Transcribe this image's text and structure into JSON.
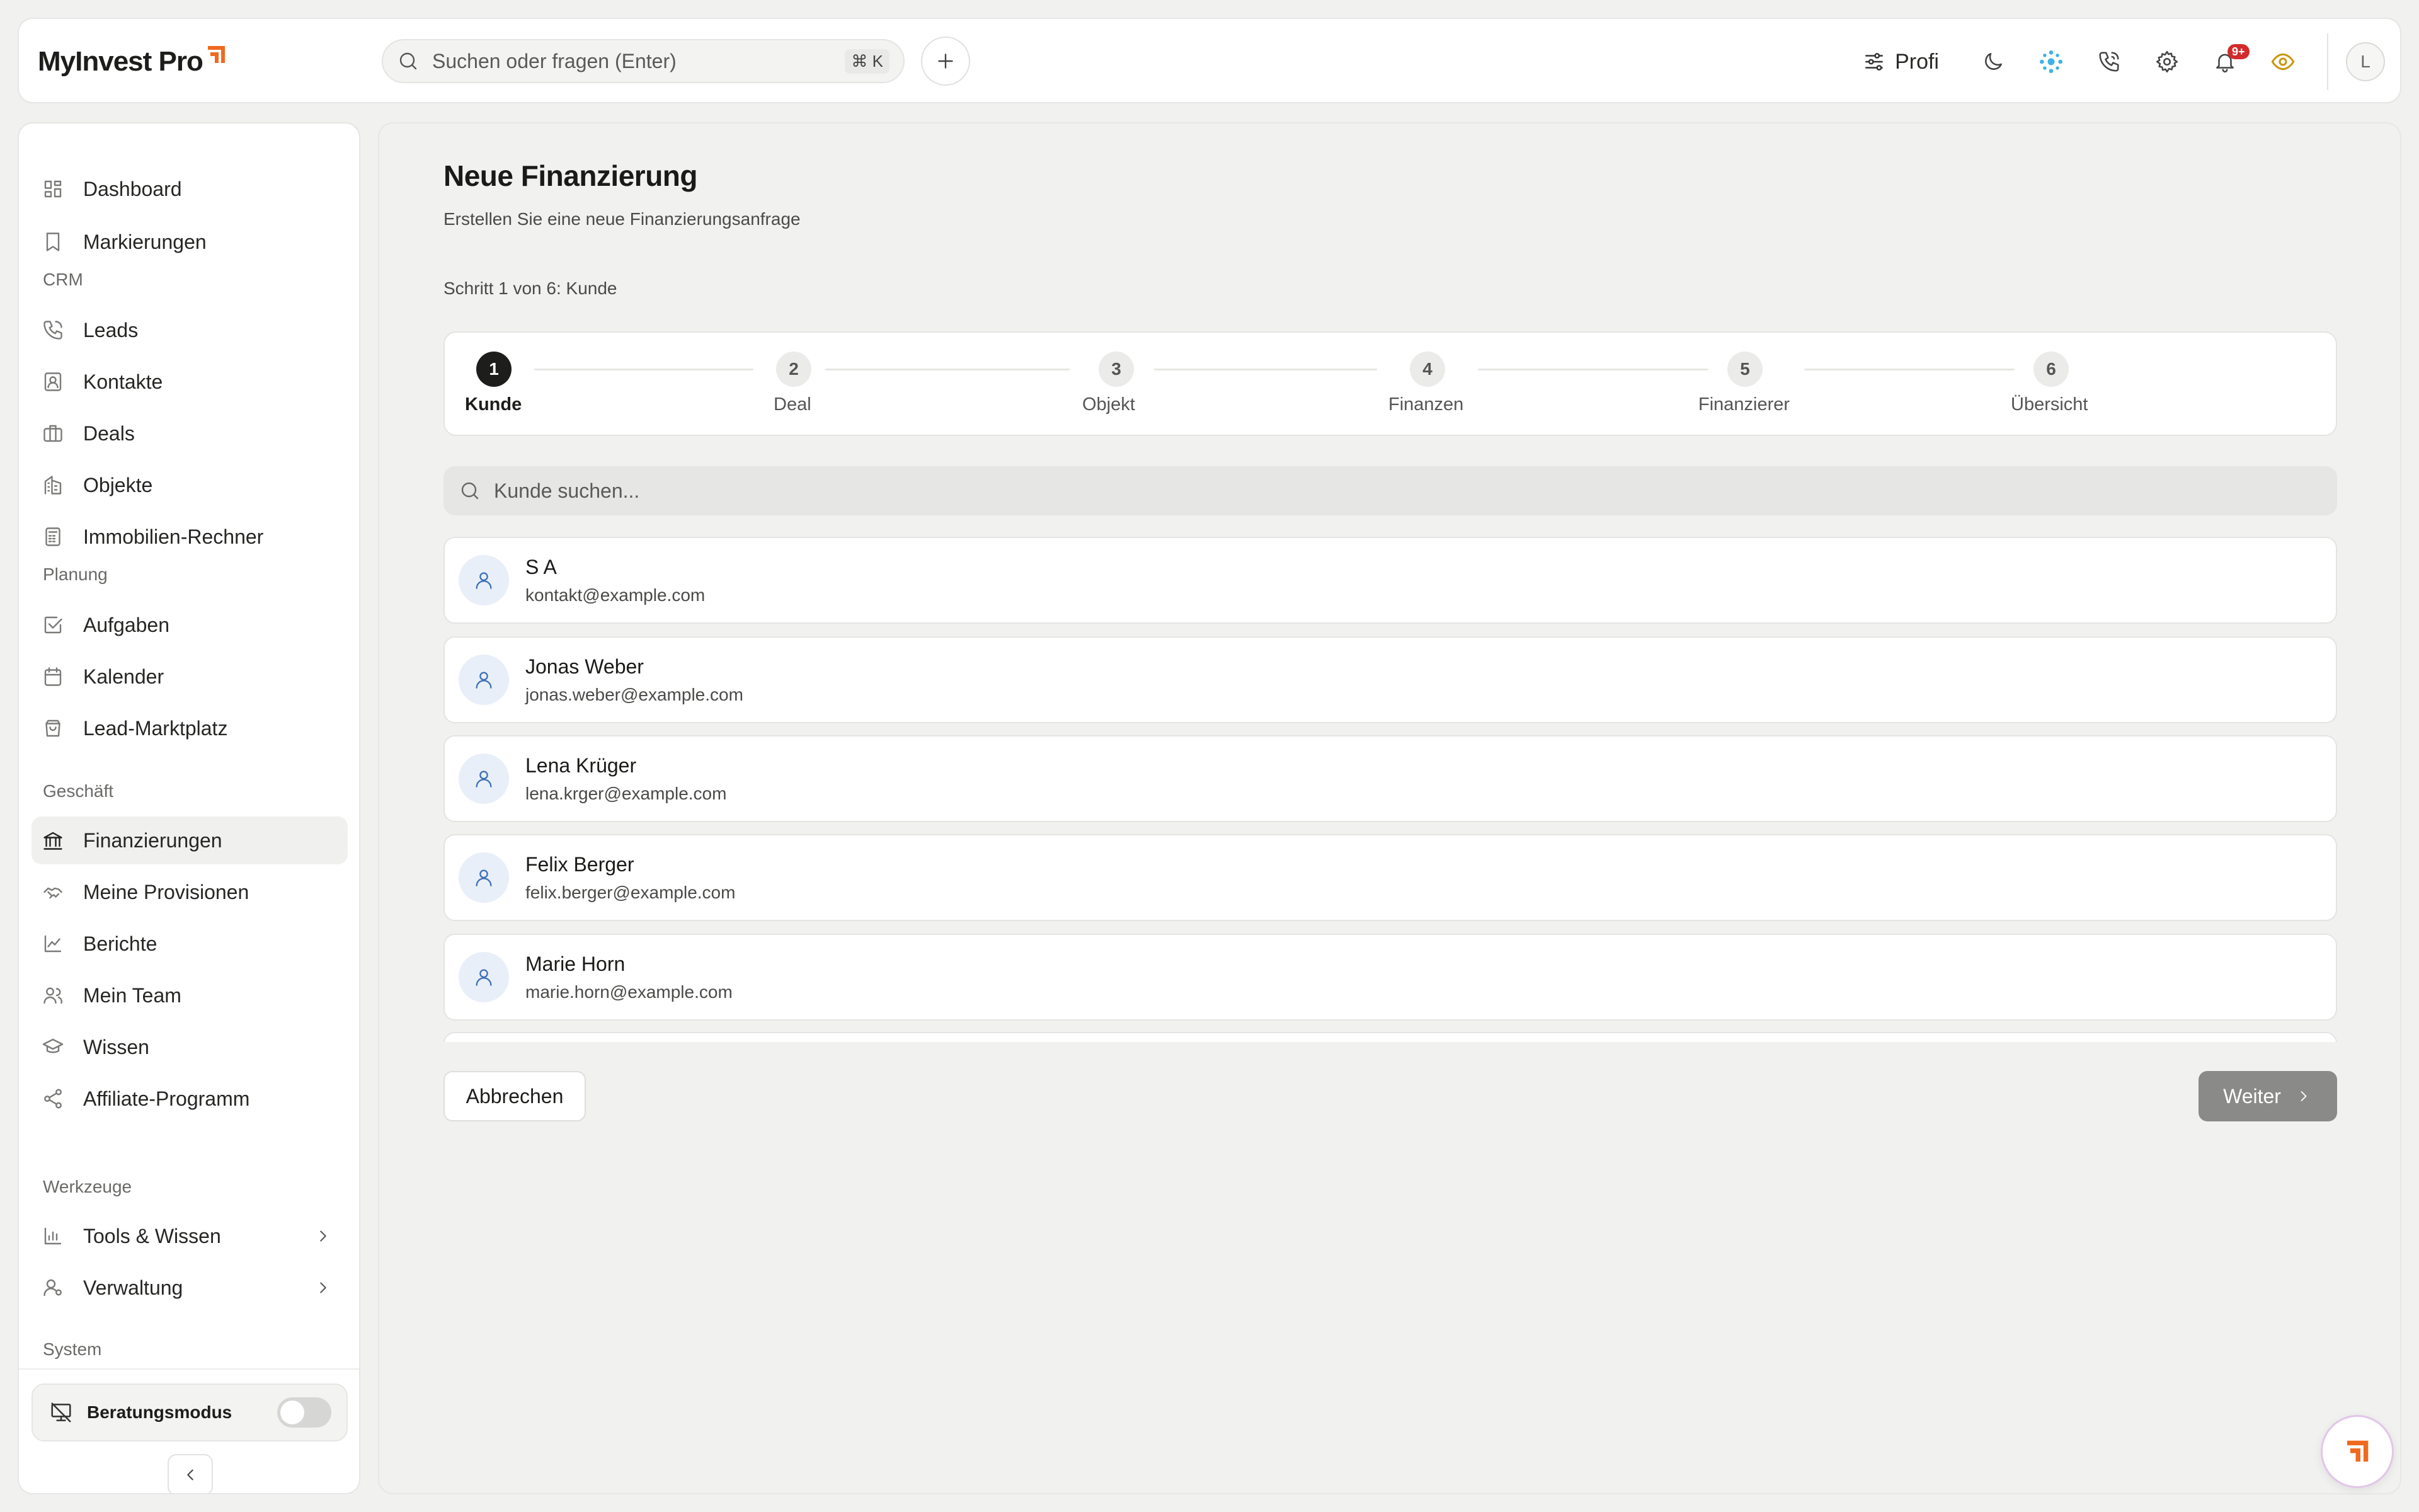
{
  "brand": {
    "name": "MyInvest Pro",
    "accent": "#ef6a1f"
  },
  "topbar": {
    "search_placeholder": "Suchen oder fragen (Enter)",
    "shortcut": "⌘ K",
    "profile_mode": "Profi",
    "notification_count": "9+",
    "avatar_initial": "L"
  },
  "sidebar": {
    "top_items": [
      {
        "label": "Dashboard",
        "icon": "dashboard-icon"
      },
      {
        "label": "Markierungen",
        "icon": "bookmark-icon"
      }
    ],
    "sections": [
      {
        "title": "CRM",
        "items": [
          {
            "label": "Leads",
            "icon": "phone-icon"
          },
          {
            "label": "Kontakte",
            "icon": "contact-icon"
          },
          {
            "label": "Deals",
            "icon": "briefcase-icon"
          },
          {
            "label": "Objekte",
            "icon": "building-icon"
          },
          {
            "label": "Immobilien-Rechner",
            "icon": "calculator-icon"
          }
        ]
      },
      {
        "title": "Planung",
        "items": [
          {
            "label": "Aufgaben",
            "icon": "checkbox-icon"
          },
          {
            "label": "Kalender",
            "icon": "calendar-icon"
          },
          {
            "label": "Lead-Marktplatz",
            "icon": "shopping-bag-icon"
          }
        ]
      },
      {
        "title": "Geschäft",
        "items": [
          {
            "label": "Finanzierungen",
            "icon": "bank-icon",
            "active": true
          },
          {
            "label": "Meine Provisionen",
            "icon": "handshake-icon"
          },
          {
            "label": "Berichte",
            "icon": "line-chart-icon"
          },
          {
            "label": "Mein Team",
            "icon": "users-icon"
          },
          {
            "label": "Wissen",
            "icon": "graduation-cap-icon"
          },
          {
            "label": "Affiliate-Programm",
            "icon": "share-icon"
          }
        ]
      },
      {
        "title": "Werkzeuge",
        "items": [
          {
            "label": "Tools & Wissen",
            "icon": "bar-chart-icon",
            "expandable": true
          },
          {
            "label": "Verwaltung",
            "icon": "user-cog-icon",
            "expandable": true
          }
        ]
      },
      {
        "title": "System",
        "items": []
      }
    ],
    "advisory_mode": {
      "label": "Beratungsmodus",
      "enabled": false
    }
  },
  "page": {
    "title": "Neue Finanzierung",
    "subtitle": "Erstellen Sie eine neue Finanzierungsanfrage",
    "step_text": "Schritt 1 von 6: Kunde",
    "current_step": 1,
    "steps": [
      {
        "number": "1",
        "label": "Kunde"
      },
      {
        "number": "2",
        "label": "Deal"
      },
      {
        "number": "3",
        "label": "Objekt"
      },
      {
        "number": "4",
        "label": "Finanzen"
      },
      {
        "number": "5",
        "label": "Finanzierer"
      },
      {
        "number": "6",
        "label": "Übersicht"
      }
    ],
    "customer_search_placeholder": "Kunde suchen...",
    "customers": [
      {
        "name": "S A",
        "email": "kontakt@example.com"
      },
      {
        "name": "Jonas Weber",
        "email": "jonas.weber@example.com"
      },
      {
        "name": "Lena Krüger",
        "email": "lena.krger@example.com"
      },
      {
        "name": "Felix Berger",
        "email": "felix.berger@example.com"
      },
      {
        "name": "Marie Horn",
        "email": "marie.horn@example.com"
      }
    ],
    "cancel_label": "Abbrechen",
    "next_label": "Weiter"
  }
}
